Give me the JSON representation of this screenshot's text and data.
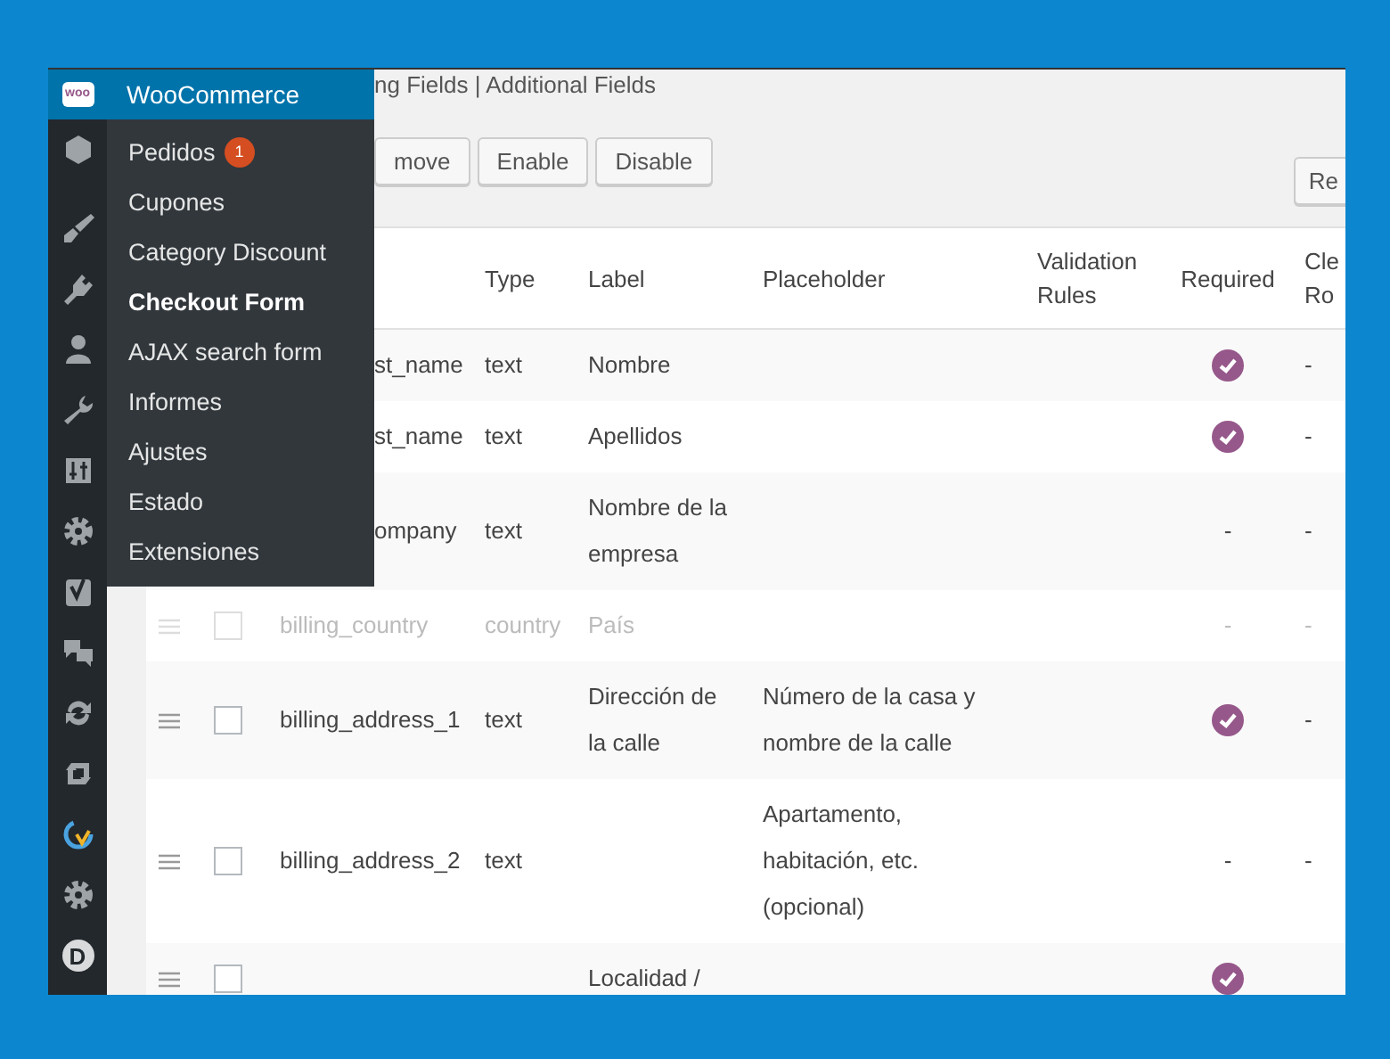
{
  "sidebar": {
    "logo_text": "woo",
    "avatar_letter": "D"
  },
  "menu": {
    "title": "WooCommerce",
    "items": [
      {
        "label": "Pedidos",
        "badge": "1",
        "selected": false
      },
      {
        "label": "Cupones",
        "selected": false
      },
      {
        "label": "Category Discount",
        "selected": false
      },
      {
        "label": "Checkout Form",
        "selected": true
      },
      {
        "label": "AJAX search form",
        "selected": false
      },
      {
        "label": "Informes",
        "selected": false
      },
      {
        "label": "Ajustes",
        "selected": false
      },
      {
        "label": "Estado",
        "selected": false
      },
      {
        "label": "Extensiones",
        "selected": false
      }
    ]
  },
  "section_links": "ng Fields | Additional Fields",
  "toolbar": {
    "buttons": [
      "move",
      "Enable",
      "Disable"
    ],
    "right_button": "Re"
  },
  "table": {
    "columns": [
      "Type",
      "Label",
      "Placeholder",
      "Validation Rules",
      "Required",
      "Cle Ro"
    ],
    "rows": [
      {
        "name": "st_name",
        "name_covered": true,
        "type": "text",
        "label": "Nombre",
        "required": true,
        "clear": "-",
        "disabled": false
      },
      {
        "name": "st_name",
        "name_covered": true,
        "type": "text",
        "label": "Apellidos",
        "required": true,
        "clear": "-",
        "disabled": false
      },
      {
        "name": "ompany",
        "name_covered": true,
        "type": "text",
        "label": "Nombre de la empresa",
        "required": false,
        "required_text": "-",
        "clear": "-",
        "disabled": false
      },
      {
        "name": "billing_country",
        "name_covered": false,
        "type": "country",
        "label": "País",
        "required": false,
        "required_text": "-",
        "clear": "-",
        "checked": false,
        "disabled": true
      },
      {
        "name": "billing_address_1",
        "name_covered": false,
        "type": "text",
        "label": "Dirección de la calle",
        "hint": "Número de la casa y nombre de la calle",
        "required": true,
        "clear": "-",
        "checked": false,
        "disabled": false
      },
      {
        "name": "billing_address_2",
        "name_covered": false,
        "type": "text",
        "hint": "Apartamento, habitación, etc. (opcional)",
        "required": false,
        "required_text": "-",
        "clear": "-",
        "checked": false,
        "disabled": false
      },
      {
        "name_covered": false,
        "label": "Localidad /",
        "required": true,
        "checked": false,
        "disabled": false
      }
    ]
  }
}
